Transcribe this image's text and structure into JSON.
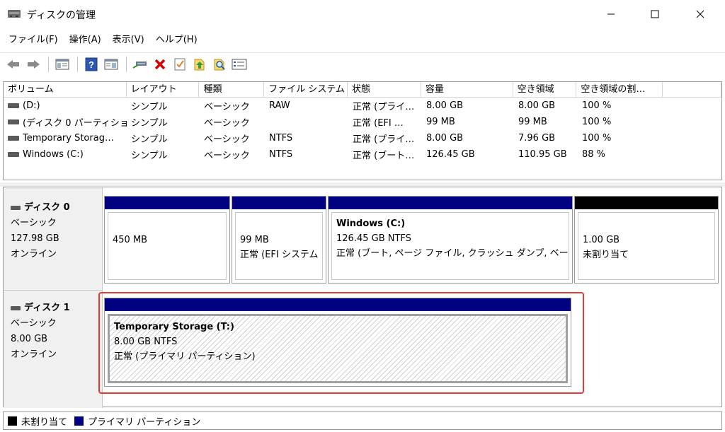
{
  "window": {
    "title": "ディスクの管理",
    "minimize": "—",
    "maximize": "☐",
    "close": "✕"
  },
  "menu": [
    "ファイル(F)",
    "操作(A)",
    "表示(V)",
    "ヘルプ(H)"
  ],
  "toolbar_icons": [
    "back-arrow-icon",
    "forward-arrow-icon",
    "properties-icon",
    "help-icon",
    "console-icon",
    "connect-icon",
    "delete-icon",
    "check-icon",
    "import-icon",
    "search-icon",
    "list-icon"
  ],
  "volume_table": {
    "headers": [
      "ボリューム",
      "レイアウト",
      "種類",
      "ファイル システム",
      "状態",
      "容量",
      "空き領域",
      "空き領域の割…",
      ""
    ],
    "rows": [
      [
        "(D:)",
        "シンプル",
        "ベーシック",
        "RAW",
        "正常 (プライ…",
        "8.00 GB",
        "8.00 GB",
        "100 %"
      ],
      [
        "(ディスク 0 パーティショ…",
        "シンプル",
        "ベーシック",
        "",
        "正常 (EFI …",
        "99 MB",
        "99 MB",
        "100 %"
      ],
      [
        "Temporary Storag…",
        "シンプル",
        "ベーシック",
        "NTFS",
        "正常 (プライ…",
        "8.00 GB",
        "7.96 GB",
        "100 %"
      ],
      [
        "Windows (C:)",
        "シンプル",
        "ベーシック",
        "NTFS",
        "正常 (ブート…",
        "126.45 GB",
        "110.95 GB",
        "88 %"
      ]
    ]
  },
  "disks": [
    {
      "name": "ディスク 0",
      "type": "ベーシック",
      "size": "127.98 GB",
      "status": "オンライン",
      "partitions": [
        {
          "title": "",
          "line1": "450 MB",
          "line2": ""
        },
        {
          "title": "",
          "line1": "99 MB",
          "line2": "正常 (EFI システム"
        },
        {
          "title": "Windows  (C:)",
          "line1": "126.45 GB NTFS",
          "line2": "正常 (ブート, ページ ファイル, クラッシュ ダンプ, ベーシッ:"
        },
        {
          "title": "",
          "line1": "1.00 GB",
          "line2": "未割り当て"
        }
      ]
    },
    {
      "name": "ディスク 1",
      "type": "ベーシック",
      "size": "8.00 GB",
      "status": "オンライン",
      "partitions": [
        {
          "title": "Temporary Storage  (T:)",
          "line1": "8.00 GB NTFS",
          "line2": "正常 (プライマリ パーティション)"
        }
      ]
    }
  ],
  "legend": {
    "unallocated": "未割り当て",
    "primary": "プライマリ パーティション"
  },
  "colors": {
    "primary_partition": "#000080",
    "unallocated": "#000000",
    "highlight": "#e53935"
  }
}
